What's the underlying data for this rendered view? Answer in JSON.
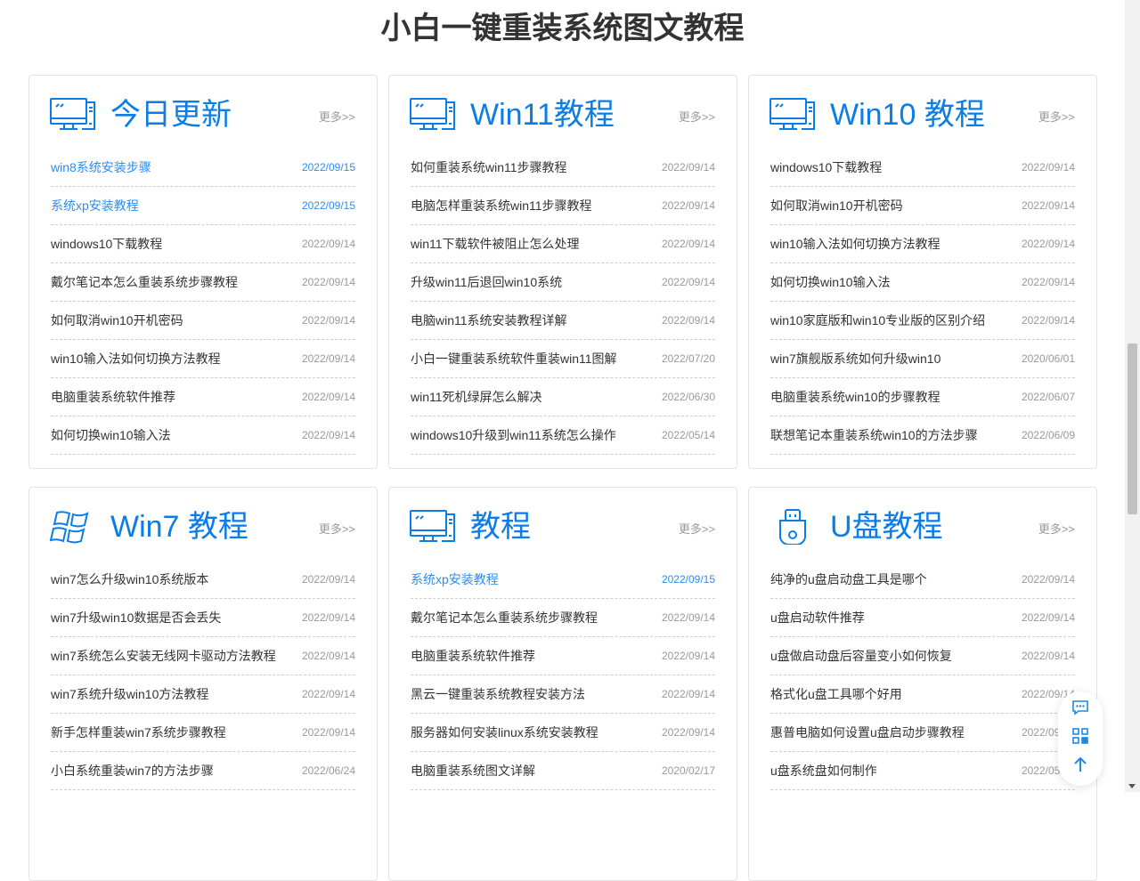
{
  "page_title": "小白一键重装系统图文教程",
  "more_label": "更多>>",
  "accent": "#0a7de8",
  "cards": [
    {
      "title": "今日更新",
      "icon": "monitor-icon",
      "items": [
        {
          "t": "win8系统安装步骤",
          "d": "2022/09/15",
          "hl": true
        },
        {
          "t": "系统xp安装教程",
          "d": "2022/09/15",
          "hl": true
        },
        {
          "t": "windows10下载教程",
          "d": "2022/09/14"
        },
        {
          "t": "戴尔笔记本怎么重装系统步骤教程",
          "d": "2022/09/14"
        },
        {
          "t": "如何取消win10开机密码",
          "d": "2022/09/14"
        },
        {
          "t": "win10输入法如何切换方法教程",
          "d": "2022/09/14"
        },
        {
          "t": "电脑重装系统软件推荐",
          "d": "2022/09/14"
        },
        {
          "t": "如何切换win10输入法",
          "d": "2022/09/14"
        }
      ]
    },
    {
      "title": "Win11教程",
      "icon": "monitor-icon",
      "items": [
        {
          "t": "如何重装系统win11步骤教程",
          "d": "2022/09/14"
        },
        {
          "t": "电脑怎样重装系统win11步骤教程",
          "d": "2022/09/14"
        },
        {
          "t": "win11下载软件被阻止怎么处理",
          "d": "2022/09/14"
        },
        {
          "t": "升级win11后退回win10系统",
          "d": "2022/09/14"
        },
        {
          "t": "电脑win11系统安装教程详解",
          "d": "2022/09/14"
        },
        {
          "t": "小白一键重装系统软件重装win11图解",
          "d": "2022/07/20"
        },
        {
          "t": "win11死机绿屏怎么解决",
          "d": "2022/06/30"
        },
        {
          "t": "windows10升级到win11系统怎么操作",
          "d": "2022/05/14"
        }
      ]
    },
    {
      "title": "Win10 教程",
      "icon": "monitor-icon",
      "items": [
        {
          "t": "windows10下载教程",
          "d": "2022/09/14"
        },
        {
          "t": "如何取消win10开机密码",
          "d": "2022/09/14"
        },
        {
          "t": "win10输入法如何切换方法教程",
          "d": "2022/09/14"
        },
        {
          "t": "如何切换win10输入法",
          "d": "2022/09/14"
        },
        {
          "t": "win10家庭版和win10专业版的区别介绍",
          "d": "2022/09/14"
        },
        {
          "t": "win7旗舰版系统如何升级win10",
          "d": "2020/06/01"
        },
        {
          "t": "电脑重装系统win10的步骤教程",
          "d": "2022/06/07"
        },
        {
          "t": "联想笔记本重装系统win10的方法步骤",
          "d": "2022/06/09"
        }
      ]
    },
    {
      "title": "Win7 教程",
      "icon": "windows-logo-icon",
      "items": [
        {
          "t": "win7怎么升级win10系统版本",
          "d": "2022/09/14"
        },
        {
          "t": "win7升级win10数据是否会丢失",
          "d": "2022/09/14"
        },
        {
          "t": "win7系统怎么安装无线网卡驱动方法教程",
          "d": "2022/09/14"
        },
        {
          "t": "win7系统升级win10方法教程",
          "d": "2022/09/14"
        },
        {
          "t": "新手怎样重装win7系统步骤教程",
          "d": "2022/09/14"
        },
        {
          "t": "小白系统重装win7的方法步骤",
          "d": "2022/06/24"
        }
      ]
    },
    {
      "title": "教程",
      "icon": "monitor-icon",
      "items": [
        {
          "t": "系统xp安装教程",
          "d": "2022/09/15",
          "hl": true
        },
        {
          "t": "戴尔笔记本怎么重装系统步骤教程",
          "d": "2022/09/14"
        },
        {
          "t": "电脑重装系统软件推荐",
          "d": "2022/09/14"
        },
        {
          "t": "黑云一键重装系统教程安装方法",
          "d": "2022/09/14"
        },
        {
          "t": "服务器如何安装linux系统安装教程",
          "d": "2022/09/14"
        },
        {
          "t": "电脑重装系统图文详解",
          "d": "2020/02/17"
        }
      ]
    },
    {
      "title": "U盘教程",
      "icon": "usb-drive-icon",
      "items": [
        {
          "t": "纯净的u盘启动盘工具是哪个",
          "d": "2022/09/14"
        },
        {
          "t": "u盘启动软件推荐",
          "d": "2022/09/14"
        },
        {
          "t": "u盘做启动盘后容量变小如何恢复",
          "d": "2022/09/14"
        },
        {
          "t": "格式化u盘工具哪个好用",
          "d": "2022/09/14"
        },
        {
          "t": "惠普电脑如何设置u盘启动步骤教程",
          "d": "2022/09/14"
        },
        {
          "t": "u盘系统盘如何制作",
          "d": "2022/05/14"
        }
      ]
    }
  ]
}
